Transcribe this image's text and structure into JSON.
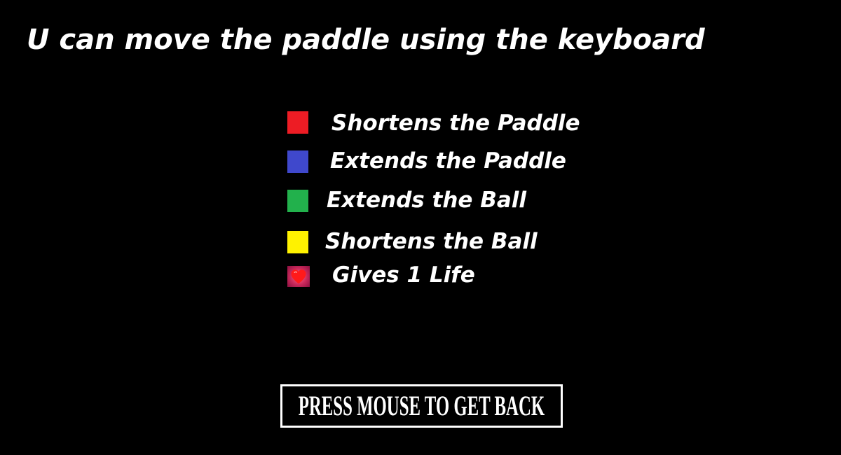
{
  "instructions": {
    "headline": "U can move the paddle using the keyboard"
  },
  "legend": {
    "items": [
      {
        "swatch_color": "#ed1c24",
        "icon": "red-square-icon",
        "label": "Shortens the Paddle"
      },
      {
        "swatch_color": "#3f48cc",
        "icon": "blue-square-icon",
        "label": "Extends the Paddle"
      },
      {
        "swatch_color": "#22b14c",
        "icon": "green-square-icon",
        "label": "Extends the Ball"
      },
      {
        "swatch_color": "#fff200",
        "icon": "yellow-square-icon",
        "label": "Shortens the Ball"
      },
      {
        "swatch_color": "#e8294a",
        "icon": "heart-icon",
        "label": "Gives 1 Life"
      }
    ]
  },
  "back_button": {
    "label": "PRESS MOUSE TO GET BACK"
  },
  "colors": {
    "background": "#000000",
    "text": "#ffffff",
    "button_border": "#ffffff"
  }
}
